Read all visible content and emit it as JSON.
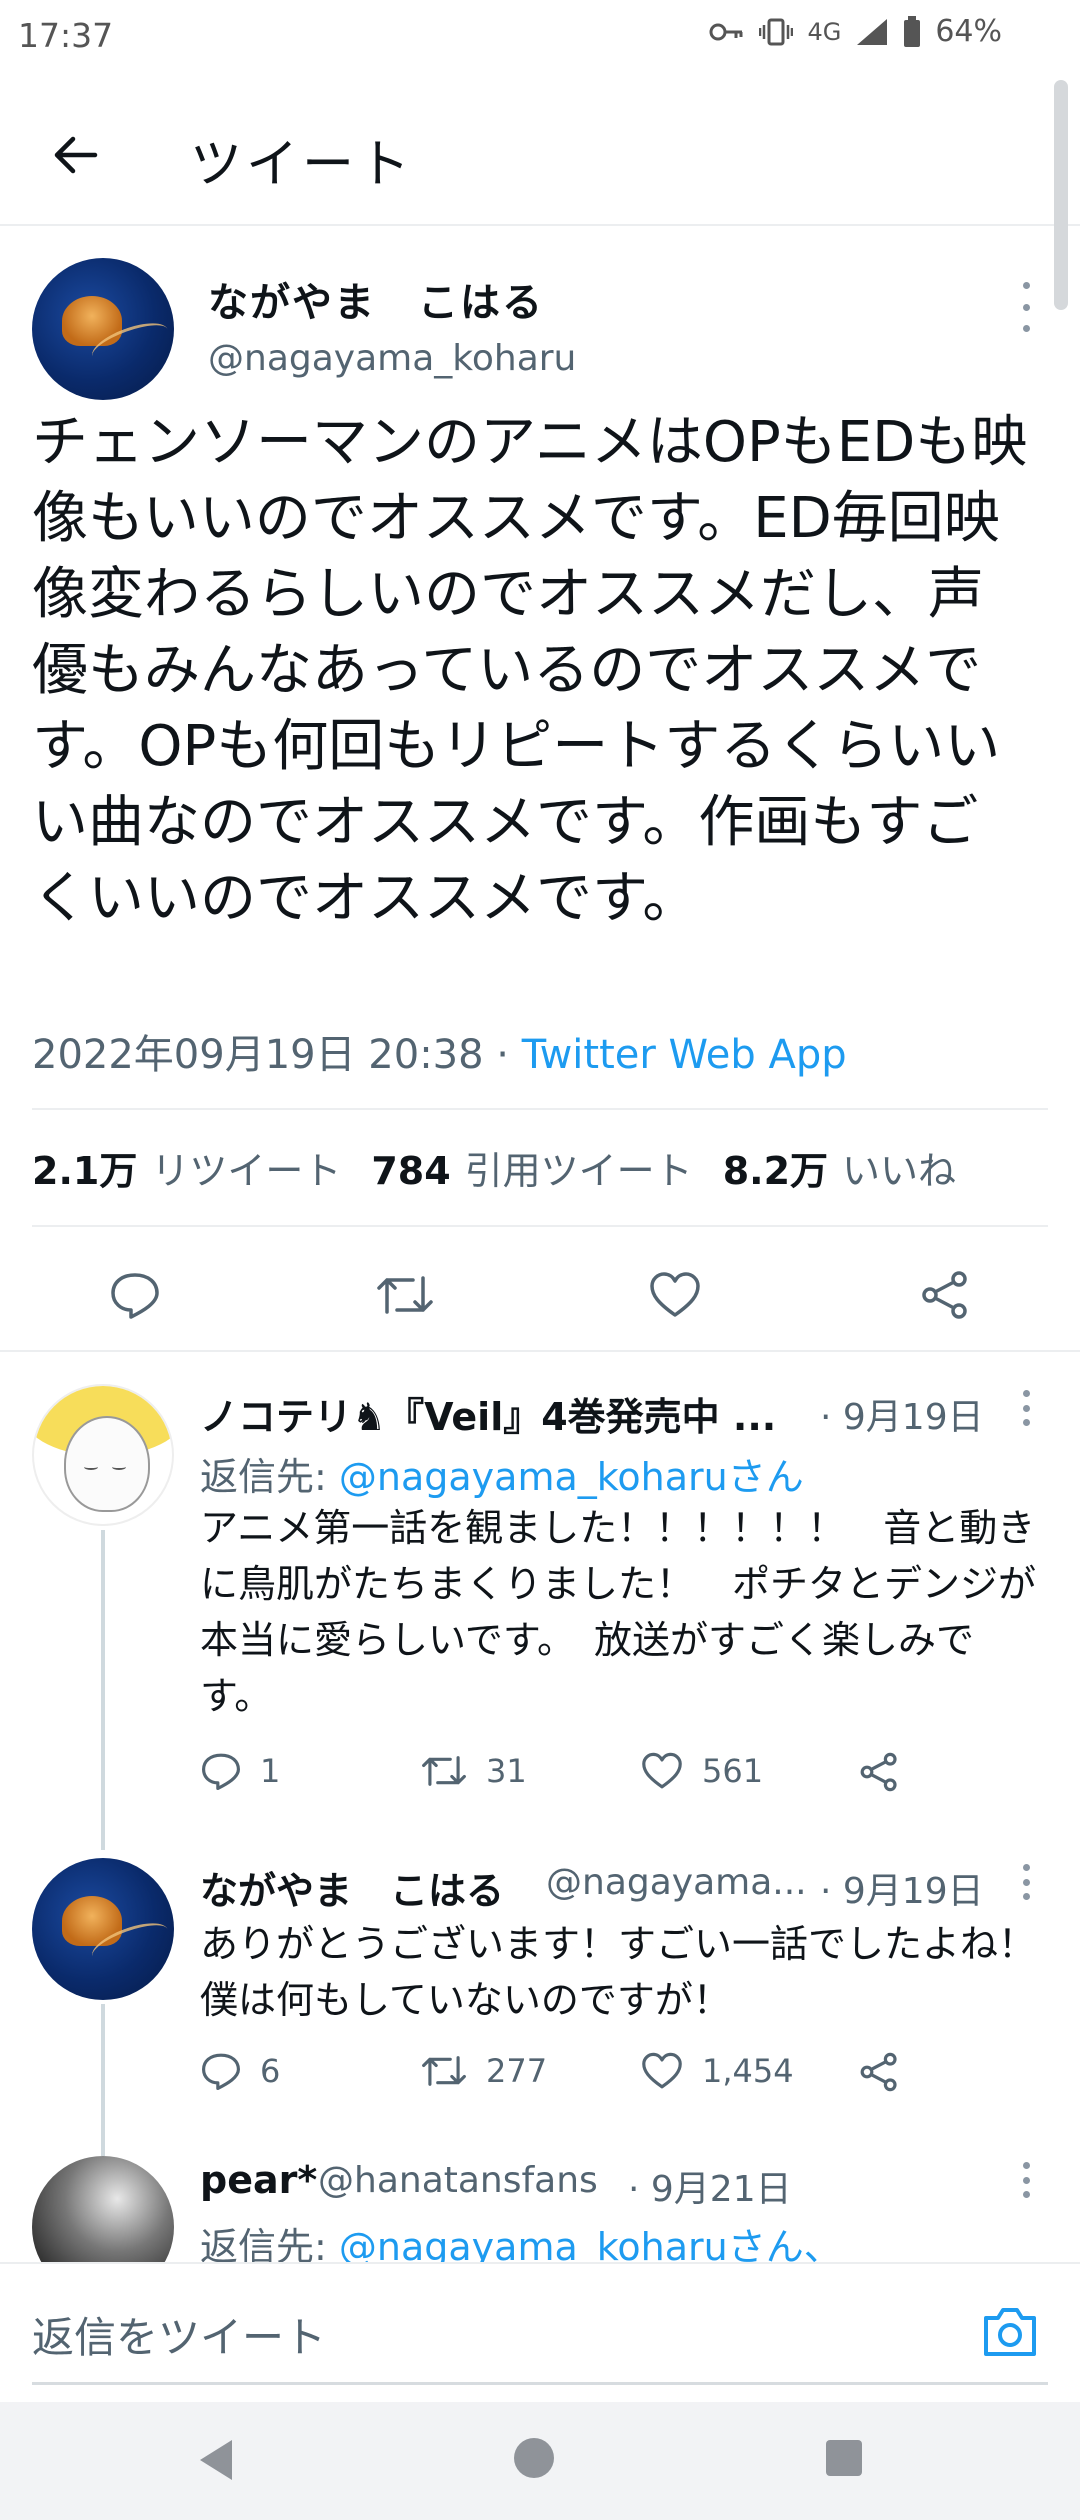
{
  "status_bar": {
    "time": "17:37",
    "network": "4G",
    "battery": "64%"
  },
  "header": {
    "title": "ツイート"
  },
  "main_tweet": {
    "display_name": "ながやま　こはる",
    "handle": "@nagayama_koharu",
    "text": "チェンソーマンのアニメはOPもEDも映像もいいのでオススメです。ED毎回映像変わるらしいのでオススメだし、声優もみんなあっているのでオススメです。OPも何回もリピートするくらいいい曲なのでオススメです。作画もすごくいいのでオススメです。",
    "timestamp": "2022年09月19日 20:38",
    "separator": " · ",
    "source": "Twitter Web App",
    "stats": {
      "retweets_count": "2.1万",
      "retweets_label": "リツイート",
      "quotes_count": "784",
      "quotes_label": "引用ツイート",
      "likes_count": "8.2万",
      "likes_label": "いいね"
    }
  },
  "replies": [
    {
      "display_name": "ノコテリ♞『Veil』4巻発売中 ...",
      "date": "· 9月19日",
      "reply_to_label": "返信先: ",
      "reply_to_handle": "@nagayama_koharuさん",
      "text": "アニメ第一話を観ました！！！！！！　音と動きに鳥肌がたちまくりました！　ポチタとデンジが本当に愛らしいです。　放送がすごく楽しみです。",
      "reply_count": "1",
      "retweet_count": "31",
      "like_count": "561"
    },
    {
      "display_name": "ながやま　こはる",
      "handle": "@nagayama...",
      "date": "· 9月19日",
      "text": "ありがとうございます！すごい一話でしたよね！僕は何もしていないのですが！",
      "reply_count": "6",
      "retweet_count": "277",
      "like_count": "1,454"
    },
    {
      "display_name": "pear*",
      "handle": "@hanatansfans",
      "date": "· 9月21日",
      "reply_to_label": "返信先: ",
      "reply_to_handle": "@nagayama_koharuさん、"
    }
  ],
  "compose": {
    "placeholder": "返信をツイート"
  },
  "icons": {
    "back": "arrow-left-icon",
    "reply": "reply-icon",
    "retweet": "retweet-icon",
    "like": "heart-icon",
    "share": "share-icon",
    "camera": "camera-icon"
  },
  "colors": {
    "accent": "#1d9bf0",
    "text": "#0f1419",
    "secondary": "#536471"
  }
}
